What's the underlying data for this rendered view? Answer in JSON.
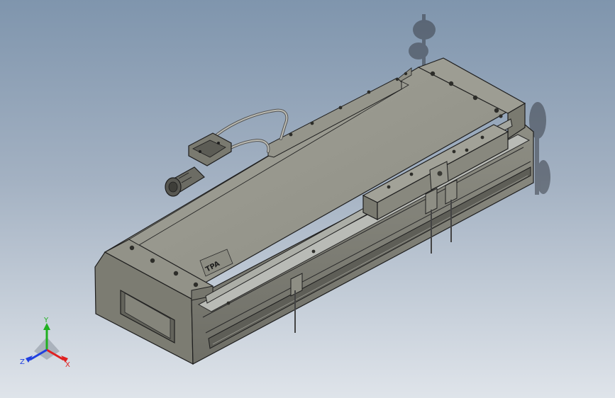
{
  "viewport": {
    "background_top": "#7f95ad",
    "background_bottom": "#dfe4ea"
  },
  "model": {
    "body_color": "#8a8a80",
    "top_color": "#98988e",
    "rail_color": "#b9bbb6",
    "edge_color": "#1e1e1e",
    "logo_text": "TPA"
  },
  "triad": {
    "x_label": "X",
    "y_label": "Y",
    "z_label": "Z",
    "x_color": "#e02020",
    "y_color": "#20b020",
    "z_color": "#2040e0"
  }
}
